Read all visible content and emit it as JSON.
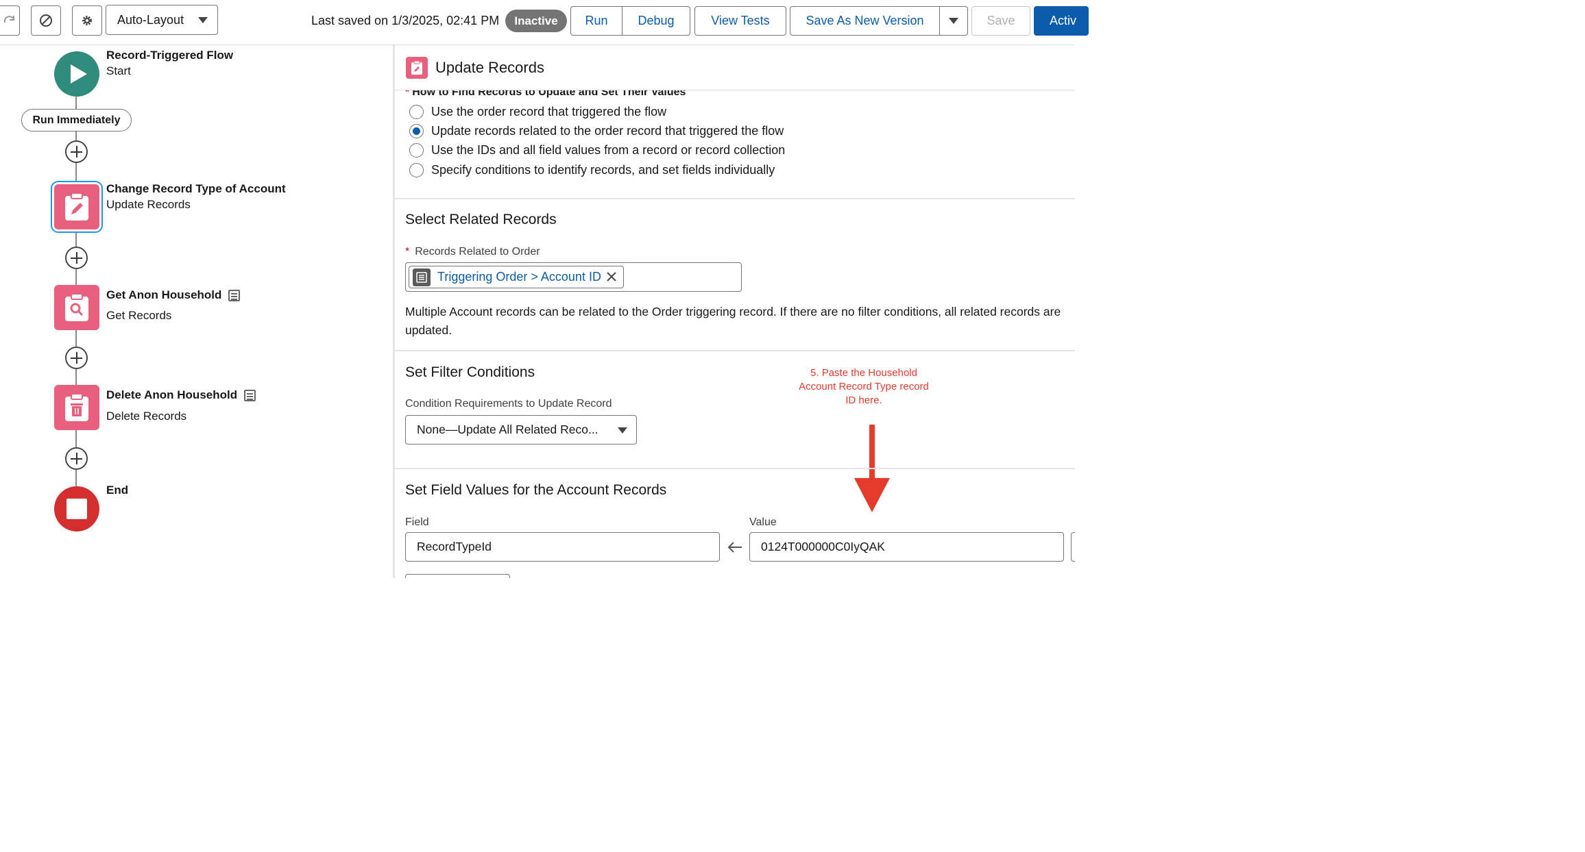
{
  "toolbar": {
    "auto_layout_label": "Auto-Layout",
    "last_saved": "Last saved on 1/3/2025, 02:41 PM",
    "status_badge": "Inactive",
    "run_label": "Run",
    "debug_label": "Debug",
    "view_tests_label": "View Tests",
    "save_as_new_version_label": "Save As New Version",
    "save_label": "Save",
    "activate_label": "Activ"
  },
  "canvas": {
    "start": {
      "title": "Record-Triggered Flow",
      "subtitle": "Start"
    },
    "run_immediately_label": "Run Immediately",
    "nodes": [
      {
        "title": "Change Record Type of Account",
        "subtitle": "Update Records",
        "icon": "update-records-icon"
      },
      {
        "title": "Get Anon Household",
        "subtitle": "Get Records",
        "icon": "get-records-icon"
      },
      {
        "title": "Delete Anon Household",
        "subtitle": "Delete Records",
        "icon": "delete-records-icon"
      }
    ],
    "end": {
      "title": "End"
    }
  },
  "panel": {
    "title": "Update Records",
    "how_to_find_label": "How to Find Records to Update and Set Their Values",
    "radio_options": [
      "Use the order record that triggered the flow",
      "Update records related to the order record that triggered the flow",
      "Use the IDs and all field values from a record or record collection",
      "Specify conditions to identify records, and set fields individually"
    ],
    "selected_radio_index": 1,
    "select_related": {
      "title": "Select Related Records",
      "field_label": "Records Related to Order",
      "pill_label": "Triggering Order > Account ID",
      "help_text": "Multiple Account records can be related to the Order triggering record. If there are no filter conditions, all related records are updated."
    },
    "filter": {
      "title": "Set Filter Conditions",
      "condition_label": "Condition Requirements to Update Record",
      "condition_value": "None—Update All Related Reco..."
    },
    "annotation": "5. Paste the Household Account Record Type record ID here.",
    "field_values": {
      "title": "Set Field Values for the Account Records",
      "field_label": "Field",
      "value_label": "Value",
      "field_value": "RecordTypeId",
      "value_value": "0124T000000C0IyQAK"
    }
  },
  "colors": {
    "accent_blue": "#0b5cab",
    "flow_pink": "#e8607e",
    "start_teal": "#2f8b7c",
    "end_red": "#d32f2f",
    "annotation_red": "#e43b2c"
  }
}
